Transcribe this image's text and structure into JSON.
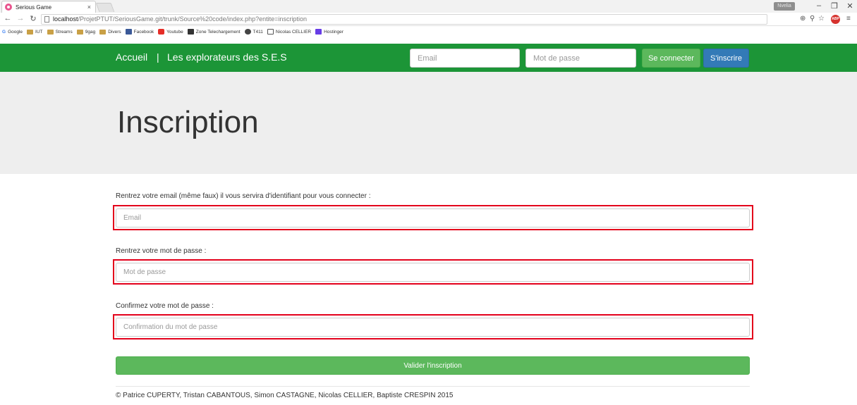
{
  "browser": {
    "tab_title": "Serious Game",
    "tab_close": "×",
    "profile_chip": "Nvelia",
    "url_host": "localhost",
    "url_path": "/ProjetPTUT/SeriousGame.git/trunk/Source%20code/index.php?entite=inscription",
    "bookmarks": [
      "Google",
      "IUT",
      "Streams",
      "9gag",
      "Divers",
      "Facebook",
      "Youtube",
      "Zone Telechargement",
      "T411",
      "Nicolas CELLIER",
      "Hostinger"
    ]
  },
  "navbar": {
    "home": "Accueil",
    "separator": "|",
    "brand": "Les explorateurs des S.E.S",
    "email_placeholder": "Email",
    "password_placeholder": "Mot de passe",
    "login_label": "Se connecter",
    "signup_label": "S'inscrire"
  },
  "page": {
    "title": "Inscription"
  },
  "form": {
    "email_label": "Rentrez votre email (même faux) il vous servira d'identifiant pour vous connecter :",
    "email_placeholder": "Email",
    "password_label": "Rentrez votre mot de passe :",
    "password_placeholder": "Mot de passe",
    "confirm_label": "Confirmez votre mot de passe :",
    "confirm_placeholder": "Confirmation du mot de passe",
    "submit_label": "Valider l'inscription"
  },
  "footer": {
    "text": "© Patrice CUPERTY, Tristan CABANTOUS, Simon CASTAGNE, Nicolas CELLIER, Baptiste CRESPIN 2015"
  },
  "colors": {
    "navbar": "#1c9537",
    "success": "#5cb85c",
    "primary": "#337ab7",
    "highlight": "#e3001b"
  }
}
